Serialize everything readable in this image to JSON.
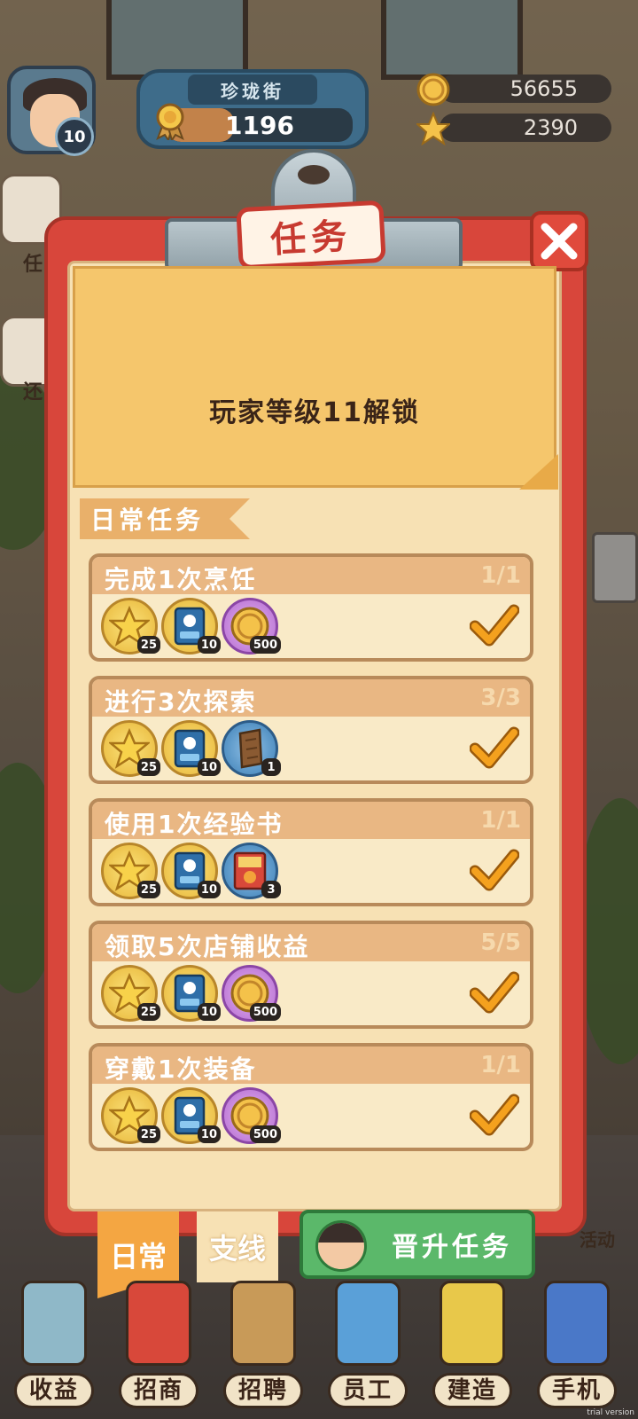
{
  "hud": {
    "player_level": "10",
    "street_name": "珍珑街",
    "xp_value": "1196",
    "xp_progress": 0.36,
    "coins": "56655",
    "stars": "2390"
  },
  "side": {
    "left_top_label": "任",
    "left_mid_label": "还",
    "right_event_label": "活动"
  },
  "panel": {
    "title": "任务",
    "close_icon": "close-icon",
    "unlock_notice": "玩家等级11解锁",
    "section_label": "日常任务"
  },
  "tasks": [
    {
      "title": "完成1次烹饪",
      "progress": "1/1",
      "rewards": [
        {
          "icon": "star-icon",
          "count": "25"
        },
        {
          "icon": "exp-book-icon",
          "count": "10"
        },
        {
          "icon": "coin-icon",
          "count": "500"
        }
      ]
    },
    {
      "title": "进行3次探索",
      "progress": "3/3",
      "rewards": [
        {
          "icon": "star-icon",
          "count": "25"
        },
        {
          "icon": "exp-book-icon",
          "count": "10"
        },
        {
          "icon": "wood-plank-icon",
          "count": "1"
        }
      ]
    },
    {
      "title": "使用1次经验书",
      "progress": "1/1",
      "rewards": [
        {
          "icon": "star-icon",
          "count": "25"
        },
        {
          "icon": "exp-book-icon",
          "count": "10"
        },
        {
          "icon": "recipe-book-icon",
          "count": "3"
        }
      ]
    },
    {
      "title": "领取5次店铺收益",
      "progress": "5/5",
      "rewards": [
        {
          "icon": "star-icon",
          "count": "25"
        },
        {
          "icon": "exp-book-icon",
          "count": "10"
        },
        {
          "icon": "coin-icon",
          "count": "500"
        }
      ]
    },
    {
      "title": "穿戴1次装备",
      "progress": "1/1",
      "rewards": [
        {
          "icon": "star-icon",
          "count": "25"
        },
        {
          "icon": "exp-book-icon",
          "count": "10"
        },
        {
          "icon": "coin-icon",
          "count": "500"
        }
      ]
    }
  ],
  "tabs": {
    "daily": "日常",
    "branch": "支线",
    "promotion": "晋升任务"
  },
  "nav": [
    {
      "label": "收益",
      "icon": "cash-register-icon"
    },
    {
      "label": "招商",
      "icon": "recruit-envelope-icon"
    },
    {
      "label": "招聘",
      "icon": "hiring-box-icon"
    },
    {
      "label": "员工",
      "icon": "staff-card-icon"
    },
    {
      "label": "建造",
      "icon": "build-icon"
    },
    {
      "label": "手机",
      "icon": "phone-icon"
    }
  ],
  "colors": {
    "board_red": "#d8463b",
    "paper": "#f7e1b4",
    "note_yellow": "#f5c66c",
    "check_orange": "#f4a11e",
    "promo_green": "#5bb86a"
  },
  "watermark": "trial version"
}
